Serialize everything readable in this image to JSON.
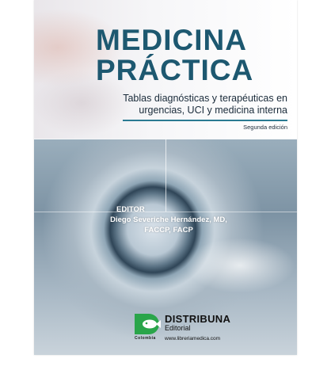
{
  "book": {
    "title_line1": "MEDICINA",
    "title_line2": "PRÁCTICA",
    "subtitle_line1": "Tablas diagnósticas y terapéuticas en",
    "subtitle_line2": "urgencias, UCI y medicina interna",
    "edition": "Segunda edición",
    "editor_label": "EDITOR",
    "editor_name_line1": "Diego Severiche Hernández, MD,",
    "editor_name_line2": "FACCP, FACP"
  },
  "publisher": {
    "name": "DISTRIBUNA",
    "subtitle": "Editorial",
    "country": "Colombia",
    "url": "www.libreriamedica.com"
  },
  "colors": {
    "title": "#1d5870",
    "accent_rule": "#2a7a92",
    "logo_green": "#2aa54a"
  },
  "icons": {
    "publisher_logo": "distribuna-fish-logo"
  }
}
